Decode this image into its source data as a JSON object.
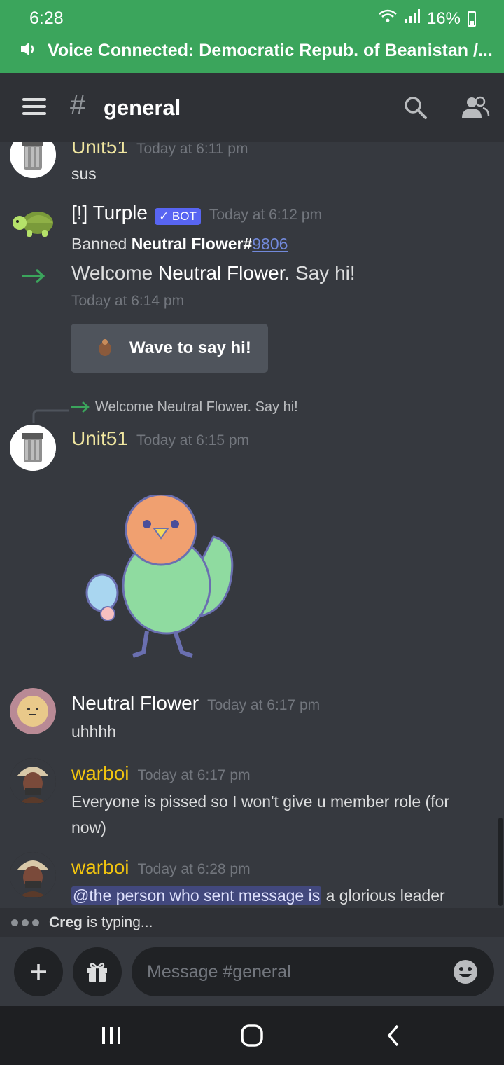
{
  "status_bar": {
    "time": "6:28",
    "battery": "16%"
  },
  "voice_bar": {
    "text": "Voice Connected: Democratic Repub. of Beanistan /..."
  },
  "header": {
    "hash": "#",
    "channel": "general"
  },
  "messages": [
    {
      "author": "Unit51",
      "timestamp": "Today at 6:11 pm",
      "text": "sus",
      "author_color": "#f0e6a0"
    },
    {
      "author": "[!] Turple",
      "badge": "✓ BOT",
      "timestamp": "Today at 6:12 pm",
      "text_prefix": "Banned ",
      "text_bold": "Neutral Flower#",
      "text_link": "9806"
    },
    {
      "system_prefix": "Welcome ",
      "system_bold": "Neutral Flower",
      "system_suffix": ". Say hi!",
      "timestamp": "Today at 6:14 pm",
      "button_label": "Wave to say hi!"
    },
    {
      "reply_text": "Welcome Neutral Flower. Say hi!",
      "author": "Unit51",
      "timestamp": "Today at 6:15 pm"
    },
    {
      "author": "Neutral Flower",
      "timestamp": "Today at 6:17 pm",
      "text": "uhhhh"
    },
    {
      "author": "warboi",
      "timestamp": "Today at 6:17 pm",
      "text_line1": "Everyone is pissed so I won't give u member role (for",
      "text_line2": "now)"
    },
    {
      "author": "warboi",
      "timestamp": "Today at 6:28 pm",
      "mention": "@the person who sent message is",
      "text": " a glorious leader"
    }
  ],
  "typing": {
    "name": "Creg",
    "rest": "is typing..."
  },
  "composer": {
    "placeholder": "Message #general"
  },
  "colors": {
    "voice_green": "#3ba55c",
    "bot_badge": "#5865f2",
    "warboi": "#f1c40f",
    "unit51": "#f0e6a0"
  }
}
